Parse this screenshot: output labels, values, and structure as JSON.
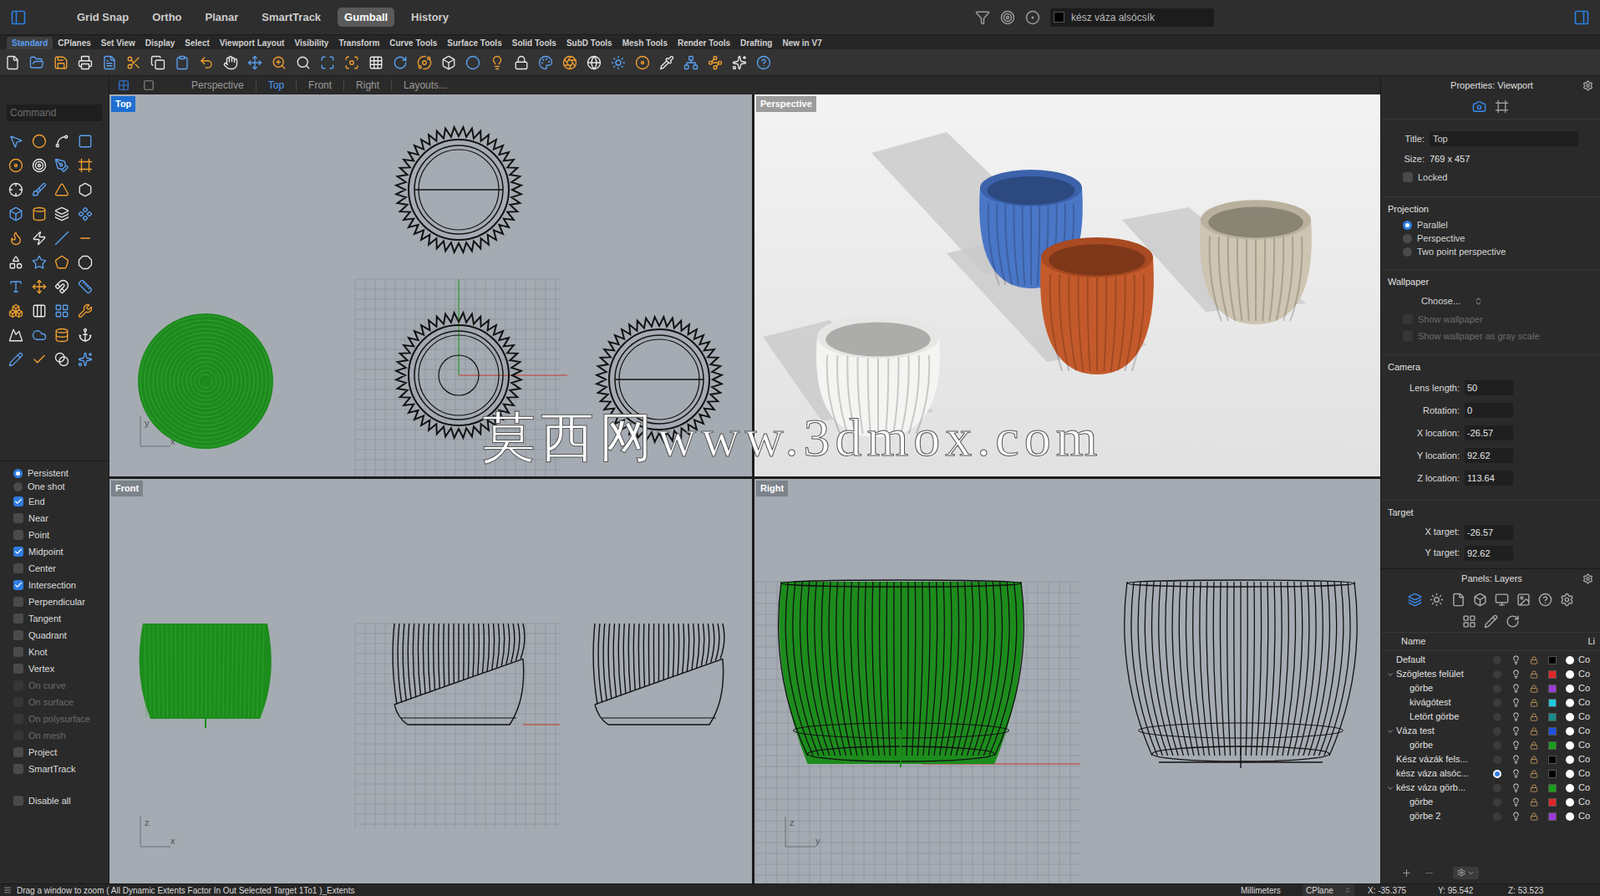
{
  "top_bar": {
    "toggles": [
      {
        "label": "Grid Snap",
        "on": false
      },
      {
        "label": "Ortho",
        "on": false
      },
      {
        "label": "Planar",
        "on": false
      },
      {
        "label": "SmartTrack",
        "on": false
      },
      {
        "label": "Gumball",
        "on": true
      },
      {
        "label": "History",
        "on": false
      }
    ],
    "current_layer": "kész váza alsócsík"
  },
  "ribbon_tabs": [
    {
      "label": "Standard",
      "selected": true
    },
    {
      "label": "CPlanes",
      "selected": false
    },
    {
      "label": "Set View",
      "selected": false
    },
    {
      "label": "Display",
      "selected": false
    },
    {
      "label": "Select",
      "selected": false
    },
    {
      "label": "Viewport Layout",
      "selected": false
    },
    {
      "label": "Visibility",
      "selected": false
    },
    {
      "label": "Transform",
      "selected": false
    },
    {
      "label": "Curve Tools",
      "selected": false
    },
    {
      "label": "Surface Tools",
      "selected": false
    },
    {
      "label": "Solid Tools",
      "selected": false
    },
    {
      "label": "SubD Tools",
      "selected": false
    },
    {
      "label": "Mesh Tools",
      "selected": false
    },
    {
      "label": "Render Tools",
      "selected": false
    },
    {
      "label": "Drafting",
      "selected": false
    },
    {
      "label": "New in V7",
      "selected": false
    }
  ],
  "viewport_tabs": [
    {
      "label": "Perspective",
      "selected": false
    },
    {
      "label": "Top",
      "selected": true
    },
    {
      "label": "Front",
      "selected": false
    },
    {
      "label": "Right",
      "selected": false
    },
    {
      "label": "Layouts...",
      "selected": false
    }
  ],
  "command": {
    "placeholder": "Command"
  },
  "osnap": {
    "modes": [
      {
        "label": "Persistent",
        "selected": true
      },
      {
        "label": "One shot",
        "selected": false
      }
    ],
    "items": [
      {
        "label": "End",
        "checked": true,
        "disabled": false
      },
      {
        "label": "Near",
        "checked": false,
        "disabled": false
      },
      {
        "label": "Point",
        "checked": false,
        "disabled": false
      },
      {
        "label": "Midpoint",
        "checked": true,
        "disabled": false
      },
      {
        "label": "Center",
        "checked": false,
        "disabled": false
      },
      {
        "label": "Intersection",
        "checked": true,
        "disabled": false
      },
      {
        "label": "Perpendicular",
        "checked": false,
        "disabled": false
      },
      {
        "label": "Tangent",
        "checked": false,
        "disabled": false
      },
      {
        "label": "Quadrant",
        "checked": false,
        "disabled": false
      },
      {
        "label": "Knot",
        "checked": false,
        "disabled": false
      },
      {
        "label": "Vertex",
        "checked": false,
        "disabled": false
      },
      {
        "label": "On curve",
        "checked": false,
        "disabled": true
      },
      {
        "label": "On surface",
        "checked": false,
        "disabled": true
      },
      {
        "label": "On polysurface",
        "checked": false,
        "disabled": true
      },
      {
        "label": "On mesh",
        "checked": false,
        "disabled": true
      },
      {
        "label": "Project",
        "checked": false,
        "disabled": false
      },
      {
        "label": "SmartTrack",
        "checked": false,
        "disabled": false
      }
    ],
    "disable_all": {
      "label": "Disable all",
      "checked": false
    }
  },
  "viewports": [
    {
      "title": "Top",
      "active": true,
      "axes": [
        "y",
        "x"
      ]
    },
    {
      "title": "Perspective",
      "active": false,
      "axes": []
    },
    {
      "title": "Front",
      "active": false,
      "axes": [
        "z",
        "x"
      ]
    },
    {
      "title": "Right",
      "active": false,
      "axes": [
        "z",
        "y"
      ]
    }
  ],
  "watermark": "莫西网www.3dmox.com",
  "properties": {
    "header": "Properties: Viewport",
    "title_label": "Title:",
    "title": "Top",
    "size_label": "Size:",
    "size": "769 x 457",
    "locked": {
      "label": "Locked",
      "checked": false
    },
    "projection": {
      "heading": "Projection",
      "options": [
        {
          "label": "Parallel",
          "selected": true
        },
        {
          "label": "Perspective",
          "selected": false
        },
        {
          "label": "Two point perspective",
          "selected": false
        }
      ]
    },
    "wallpaper": {
      "heading": "Wallpaper",
      "choose": "Choose...",
      "options": [
        {
          "label": "Show wallpaper",
          "checked": false,
          "disabled": true
        },
        {
          "label": "Show wallpaper as gray scale",
          "checked": false,
          "disabled": true
        }
      ]
    },
    "camera": {
      "heading": "Camera",
      "fields": [
        {
          "label": "Lens length:",
          "value": "50"
        },
        {
          "label": "Rotation:",
          "value": "0"
        },
        {
          "label": "X location:",
          "value": "-26.57"
        },
        {
          "label": "Y location:",
          "value": "92.62"
        },
        {
          "label": "Z location:",
          "value": "113.64"
        }
      ]
    },
    "target": {
      "heading": "Target",
      "fields": [
        {
          "label": "X target:",
          "value": "-26.57"
        },
        {
          "label": "Y target:",
          "value": "92.62"
        }
      ]
    }
  },
  "layers": {
    "header": "Panels: Layers",
    "columns": [
      "Name",
      "Li"
    ],
    "rows": [
      {
        "name": "Default",
        "level": 0,
        "has_children": false,
        "expanded": false,
        "current": false,
        "color": "#000000",
        "linetype": "Co"
      },
      {
        "name": "Szögletes felület",
        "level": 0,
        "has_children": true,
        "expanded": true,
        "current": false,
        "color": "#e0262a",
        "linetype": "Co"
      },
      {
        "name": "görbe",
        "level": 1,
        "has_children": false,
        "expanded": false,
        "current": false,
        "color": "#9a3ad8",
        "linetype": "Co"
      },
      {
        "name": "kivágótest",
        "level": 1,
        "has_children": false,
        "expanded": false,
        "current": false,
        "color": "#1ec8e0",
        "linetype": "Co"
      },
      {
        "name": "Letört görbe",
        "level": 1,
        "has_children": false,
        "expanded": false,
        "current": false,
        "color": "#1a8a8a",
        "linetype": "Co"
      },
      {
        "name": "Váza test",
        "level": 0,
        "has_children": true,
        "expanded": true,
        "current": false,
        "color": "#1d4fe0",
        "linetype": "Co"
      },
      {
        "name": "görbe",
        "level": 1,
        "has_children": false,
        "expanded": false,
        "current": false,
        "color": "#1aa01a",
        "linetype": "Co"
      },
      {
        "name": "Kész vázák fels...",
        "level": 0,
        "has_children": false,
        "expanded": false,
        "current": false,
        "color": "#000000",
        "linetype": "Co"
      },
      {
        "name": "kész váza alsóc...",
        "level": 0,
        "has_children": false,
        "expanded": false,
        "current": true,
        "color": "#000000",
        "linetype": "Co"
      },
      {
        "name": "kész váza görb...",
        "level": 0,
        "has_children": true,
        "expanded": true,
        "current": false,
        "color": "#1aa01a",
        "linetype": "Co"
      },
      {
        "name": "görbe",
        "level": 1,
        "has_children": false,
        "expanded": false,
        "current": false,
        "color": "#e0262a",
        "linetype": "Co"
      },
      {
        "name": "görbe 2",
        "level": 1,
        "has_children": false,
        "expanded": false,
        "current": false,
        "color": "#9a3ad8",
        "linetype": "Co"
      }
    ]
  },
  "status_bar": {
    "prompt": "Drag a window to zoom ( All Dynamic Extents Factor In Out Selected Target 1To1 )_Extents",
    "units": "Millimeters",
    "cplane": "CPlane",
    "x": "X: -35.375",
    "y": "Y: 95.542",
    "z": "Z: 53.523"
  }
}
